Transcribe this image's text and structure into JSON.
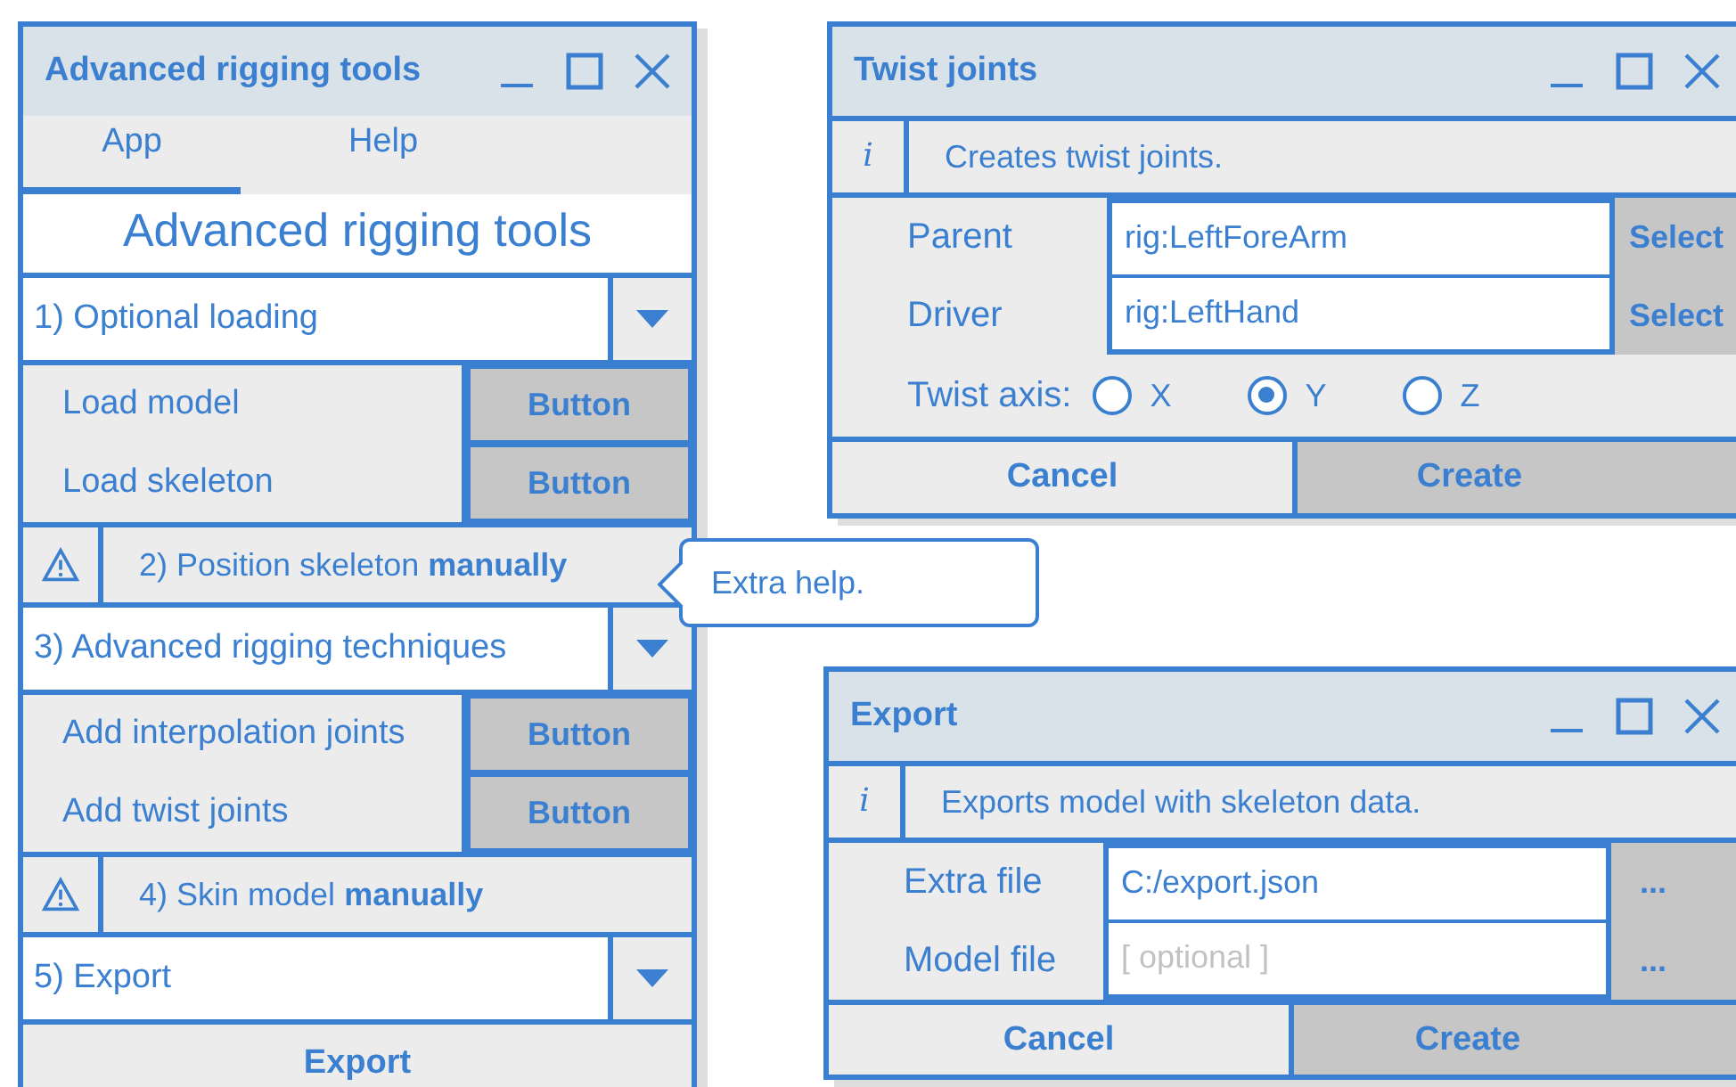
{
  "main_window": {
    "title": "Advanced rigging tools",
    "menu": [
      {
        "label": "App",
        "selected": true
      },
      {
        "label": "Help",
        "selected": false
      }
    ],
    "heading": "Advanced rigging tools",
    "sections": [
      {
        "kind": "dropdown",
        "label": "1) Optional loading",
        "rows": [
          {
            "label": "Load model",
            "button": "Button"
          },
          {
            "label": "Load skeleton",
            "button": "Button"
          }
        ]
      },
      {
        "kind": "warning",
        "label": "2) Position skeleton **manually**"
      },
      {
        "kind": "dropdown",
        "label": "3) Advanced rigging techniques",
        "rows": [
          {
            "label": "Add interpolation joints",
            "button": "Button"
          },
          {
            "label": "Add twist joints",
            "button": "Button"
          }
        ]
      },
      {
        "kind": "warning",
        "label": "4) Skin model **manually**"
      },
      {
        "kind": "dropdown",
        "label": "5) Export"
      }
    ],
    "footer_button": "Export"
  },
  "tooltip": {
    "text": "Extra help."
  },
  "twist_window": {
    "title": "Twist joints",
    "info_icon": "i",
    "info": "Creates twist joints.",
    "fields": [
      {
        "label": "Parent",
        "value": "rig:LeftForeArm",
        "button": "Select"
      },
      {
        "label": "Driver",
        "value": "rig:LeftHand",
        "button": "Select"
      }
    ],
    "radio": {
      "label": "Twist axis:",
      "options": [
        {
          "label": "X",
          "selected": false
        },
        {
          "label": "Y",
          "selected": true
        },
        {
          "label": "Z",
          "selected": false
        }
      ]
    },
    "buttons": [
      {
        "label": "Cancel",
        "kind": "secondary"
      },
      {
        "label": "Create",
        "kind": "primary"
      }
    ]
  },
  "export_window": {
    "title": "Export",
    "info_icon": "i",
    "info": "Exports model with skeleton data.",
    "fields": [
      {
        "label": "Extra file",
        "value": "C:/export.json",
        "button": "..."
      },
      {
        "label": "Model file",
        "placeholder": "[ optional ]",
        "button": "..."
      }
    ],
    "buttons": [
      {
        "label": "Cancel",
        "kind": "secondary"
      },
      {
        "label": "Create",
        "kind": "primary"
      }
    ]
  }
}
